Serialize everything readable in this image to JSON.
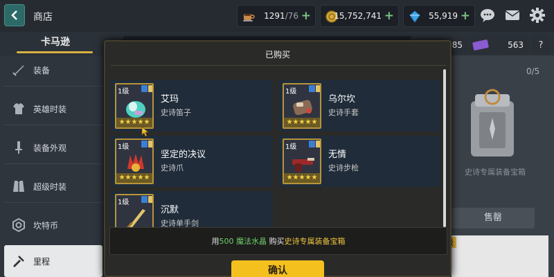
{
  "header": {
    "title": "商店",
    "resources": [
      {
        "icon": "coffee-cup-icon",
        "value": "1291",
        "sub": "/76"
      },
      {
        "icon": "gold-coin-icon",
        "value": "15,752,741",
        "sub": ""
      },
      {
        "icon": "gem-icon",
        "value": "55,919",
        "sub": ""
      }
    ]
  },
  "sidebar": {
    "hero_name": "卡马逊",
    "items": [
      {
        "label": "装备",
        "icon": "sword-icon"
      },
      {
        "label": "英雄时装",
        "icon": "costume-icon"
      },
      {
        "label": "装备外观",
        "icon": "sword-skin-icon"
      },
      {
        "label": "超级时装",
        "icon": "super-costume-icon"
      },
      {
        "label": "坎特币",
        "icon": "coin-hexagon-icon"
      },
      {
        "label": "里程",
        "icon": "mileage-icon"
      }
    ]
  },
  "right_panel": {
    "pill1_value": "85",
    "pill2_value": "563",
    "count": "0/5",
    "chest_label": "史诗专属装备宝箱",
    "sell_label": "售罄",
    "level_label": "级"
  },
  "modal": {
    "title": "已购买",
    "items": [
      {
        "level": "1级",
        "name": "艾玛",
        "type": "史诗笛子",
        "stars": "★★★★★",
        "art": "flute-art"
      },
      {
        "level": "1级",
        "name": "乌尔坎",
        "type": "史诗手套",
        "stars": "★★★★★",
        "art": "gauntlet-art"
      },
      {
        "level": "1级",
        "name": "坚定的决议",
        "type": "史诗爪",
        "stars": "★★★★★",
        "art": "claw-art"
      },
      {
        "level": "1级",
        "name": "无情",
        "type": "史诗步枪",
        "stars": "★★★★★",
        "art": "rifle-art"
      },
      {
        "level": "1级",
        "name": "沉默",
        "type": "史诗单手剑",
        "stars": "★★★★★",
        "art": "sword-art"
      }
    ],
    "footer": {
      "prefix": "用",
      "amount": "500",
      "currency": "魔法水晶",
      "middle": "购买",
      "target": "史诗专属装备宝箱"
    },
    "confirm_label": "确认"
  },
  "colors": {
    "accent_gold": "#f4c01e",
    "frame_gold": "#b8953a",
    "highlight_green": "#6fd16a",
    "highlight_yellow": "#f0c540"
  }
}
